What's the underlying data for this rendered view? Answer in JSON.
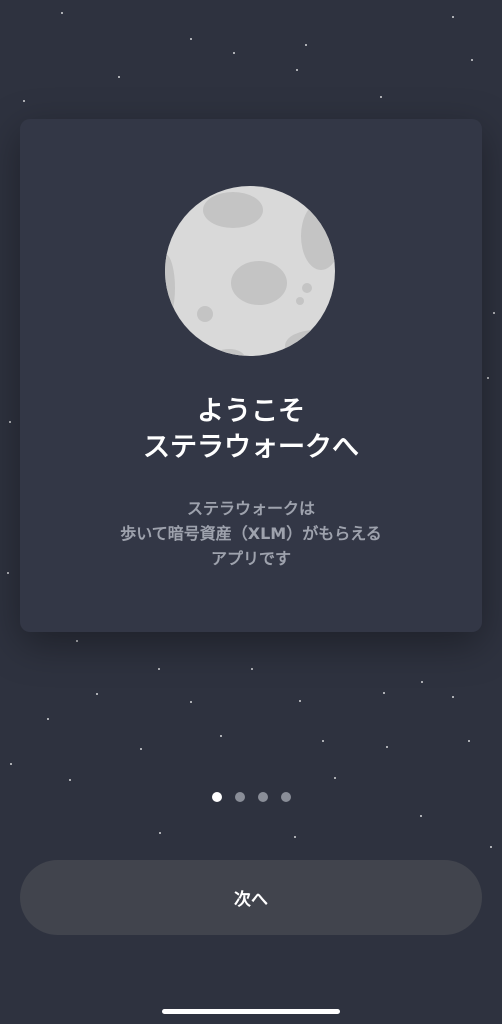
{
  "onboarding": {
    "title_line1": "ようこそ",
    "title_line2": "ステラウォークへ",
    "description_line1": "ステラウォークは",
    "description_line2": "歩いて暗号資産（XLM）がもらえる",
    "description_line3": "アプリです",
    "current_page": 1,
    "total_pages": 4,
    "image_icon": "moon-icon"
  },
  "actions": {
    "next_label": "次へ"
  },
  "colors": {
    "background": "#2e323f",
    "card": "#333746",
    "button": "#41444d",
    "moon": "#d9d9d9",
    "moon_crater": "#c4c4c4",
    "text_primary": "#ffffff",
    "text_secondary": "#9ea2ad",
    "dot_active": "#ffffff",
    "dot_inactive": "#8a8e98"
  }
}
